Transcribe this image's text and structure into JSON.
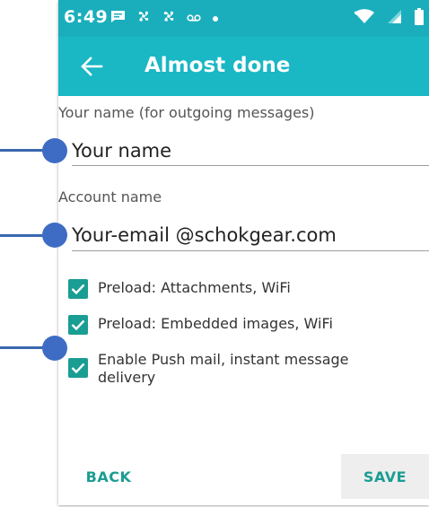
{
  "status_bar": {
    "time": "6:49",
    "notification_icons": [
      "message-icon",
      "fan-icon",
      "fan-icon",
      "voicemail-icon",
      "dot-icon"
    ],
    "right_icons": [
      "wifi-icon",
      "signal-icon",
      "battery-icon"
    ]
  },
  "app_bar": {
    "title": "Almost done",
    "back_icon": "arrow-left-icon"
  },
  "form": {
    "name_label": "Your name (for outgoing messages)",
    "name_value": "Your name",
    "account_label": "Account name",
    "account_value": "Your-email @schokgear.com"
  },
  "options": [
    {
      "label": "Preload: Attachments, WiFi",
      "checked": true
    },
    {
      "label": "Preload: Embedded images, WiFi",
      "checked": true
    },
    {
      "label": "Enable Push mail, instant message delivery",
      "checked": true
    }
  ],
  "footer": {
    "back_label": "BACK",
    "save_label": "SAVE"
  },
  "colors": {
    "status_bar": "#1aaebd",
    "app_bar": "#1ab7c5",
    "accent": "#1a9d93",
    "pointer": "#3e6cc4"
  }
}
